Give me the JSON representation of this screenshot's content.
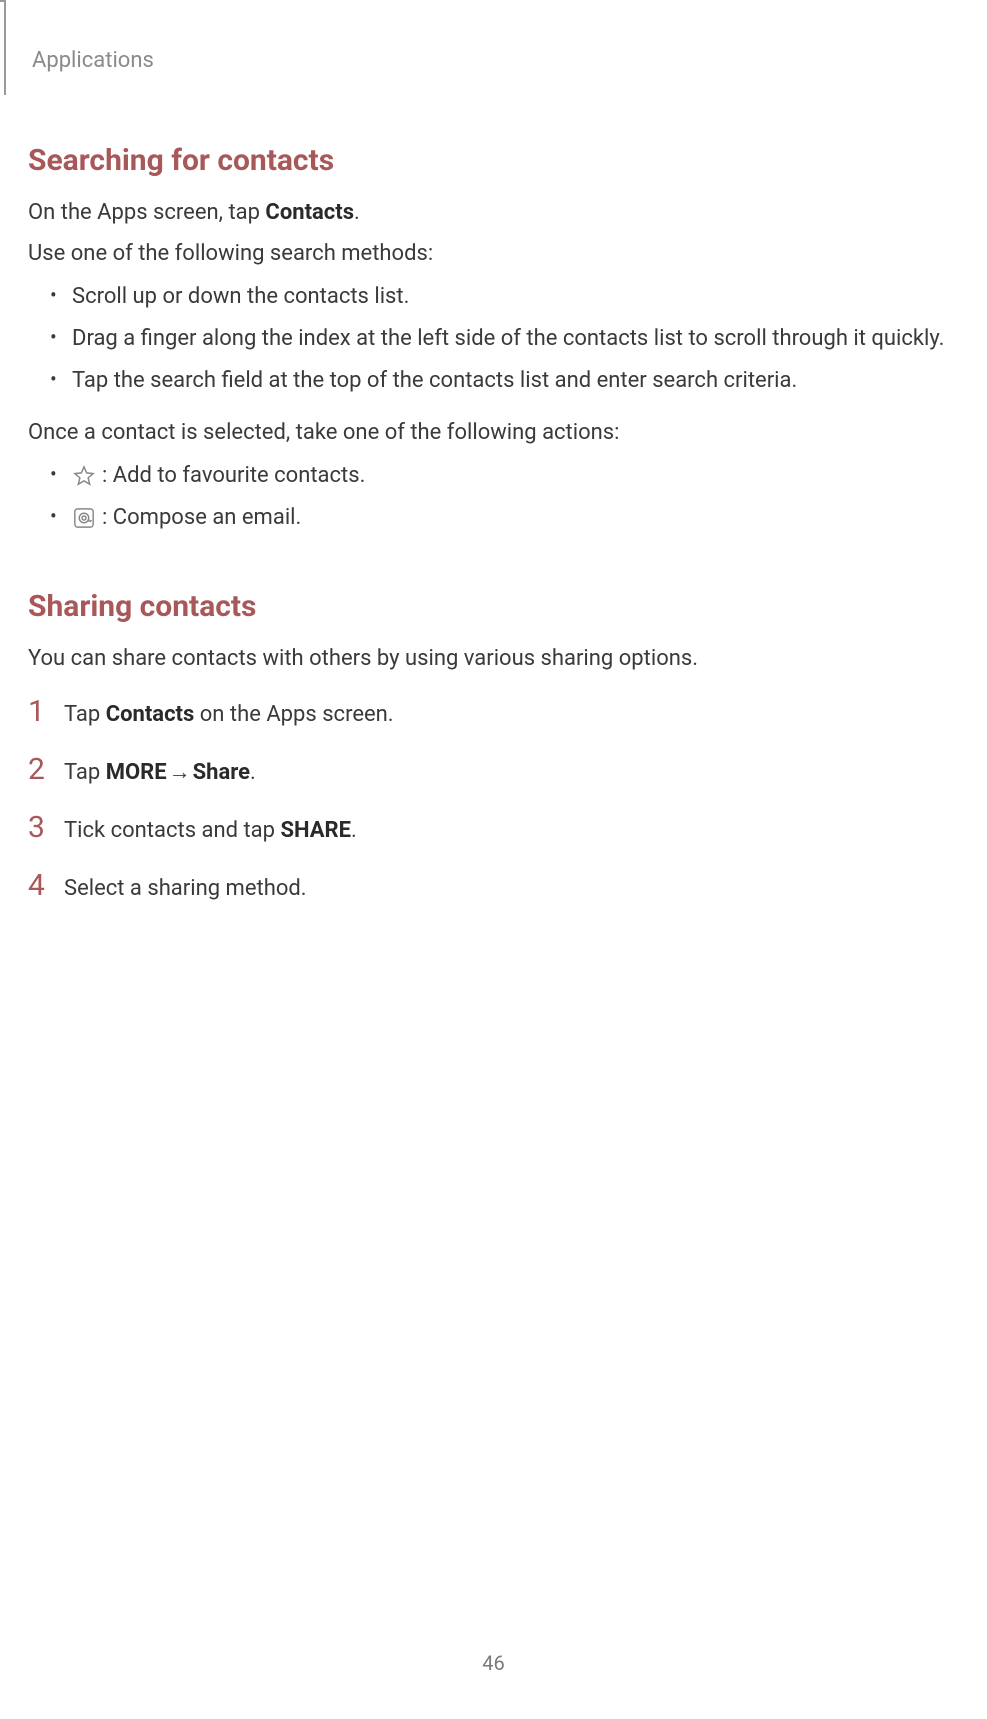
{
  "header": {
    "title": "Applications"
  },
  "sections": {
    "search": {
      "heading": "Searching for contacts",
      "intro_pre": "On the Apps screen, tap ",
      "intro_bold": "Contacts",
      "intro_post": ".",
      "methods_label": "Use one of the following search methods:",
      "bullets": [
        "Scroll up or down the contacts list.",
        "Drag a finger along the index at the left side of the contacts list to scroll through it quickly.",
        "Tap the search field at the top of the contacts list and enter search criteria."
      ],
      "actions_label": "Once a contact is selected, take one of the following actions:",
      "icon_bullets": [
        {
          "icon": "star-icon",
          "text": " : Add to favourite contacts."
        },
        {
          "icon": "email-icon",
          "text": " : Compose an email."
        }
      ]
    },
    "share": {
      "heading": "Sharing contacts",
      "intro": "You can share contacts with others by using various sharing options.",
      "steps": [
        {
          "num": "1",
          "pre": "Tap ",
          "b1": "Contacts",
          "post": " on the Apps screen."
        },
        {
          "num": "2",
          "pre": "Tap ",
          "b1": "MORE",
          "arrow": " → ",
          "b2": "Share",
          "post": "."
        },
        {
          "num": "3",
          "pre": "Tick contacts and tap ",
          "b1": "SHARE",
          "post": "."
        },
        {
          "num": "4",
          "pre": "Select a sharing method.",
          "b1": "",
          "post": ""
        }
      ]
    }
  },
  "page_number": "46"
}
